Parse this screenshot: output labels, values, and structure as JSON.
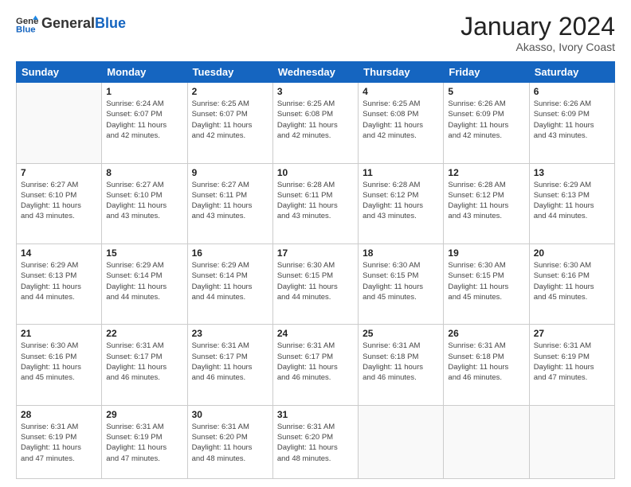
{
  "header": {
    "logo_general": "General",
    "logo_blue": "Blue",
    "month_title": "January 2024",
    "location": "Akasso, Ivory Coast"
  },
  "weekdays": [
    "Sunday",
    "Monday",
    "Tuesday",
    "Wednesday",
    "Thursday",
    "Friday",
    "Saturday"
  ],
  "weeks": [
    [
      {
        "day": "",
        "info": ""
      },
      {
        "day": "1",
        "info": "Sunrise: 6:24 AM\nSunset: 6:07 PM\nDaylight: 11 hours\nand 42 minutes."
      },
      {
        "day": "2",
        "info": "Sunrise: 6:25 AM\nSunset: 6:07 PM\nDaylight: 11 hours\nand 42 minutes."
      },
      {
        "day": "3",
        "info": "Sunrise: 6:25 AM\nSunset: 6:08 PM\nDaylight: 11 hours\nand 42 minutes."
      },
      {
        "day": "4",
        "info": "Sunrise: 6:25 AM\nSunset: 6:08 PM\nDaylight: 11 hours\nand 42 minutes."
      },
      {
        "day": "5",
        "info": "Sunrise: 6:26 AM\nSunset: 6:09 PM\nDaylight: 11 hours\nand 42 minutes."
      },
      {
        "day": "6",
        "info": "Sunrise: 6:26 AM\nSunset: 6:09 PM\nDaylight: 11 hours\nand 43 minutes."
      }
    ],
    [
      {
        "day": "7",
        "info": "Sunrise: 6:27 AM\nSunset: 6:10 PM\nDaylight: 11 hours\nand 43 minutes."
      },
      {
        "day": "8",
        "info": "Sunrise: 6:27 AM\nSunset: 6:10 PM\nDaylight: 11 hours\nand 43 minutes."
      },
      {
        "day": "9",
        "info": "Sunrise: 6:27 AM\nSunset: 6:11 PM\nDaylight: 11 hours\nand 43 minutes."
      },
      {
        "day": "10",
        "info": "Sunrise: 6:28 AM\nSunset: 6:11 PM\nDaylight: 11 hours\nand 43 minutes."
      },
      {
        "day": "11",
        "info": "Sunrise: 6:28 AM\nSunset: 6:12 PM\nDaylight: 11 hours\nand 43 minutes."
      },
      {
        "day": "12",
        "info": "Sunrise: 6:28 AM\nSunset: 6:12 PM\nDaylight: 11 hours\nand 43 minutes."
      },
      {
        "day": "13",
        "info": "Sunrise: 6:29 AM\nSunset: 6:13 PM\nDaylight: 11 hours\nand 44 minutes."
      }
    ],
    [
      {
        "day": "14",
        "info": "Sunrise: 6:29 AM\nSunset: 6:13 PM\nDaylight: 11 hours\nand 44 minutes."
      },
      {
        "day": "15",
        "info": "Sunrise: 6:29 AM\nSunset: 6:14 PM\nDaylight: 11 hours\nand 44 minutes."
      },
      {
        "day": "16",
        "info": "Sunrise: 6:29 AM\nSunset: 6:14 PM\nDaylight: 11 hours\nand 44 minutes."
      },
      {
        "day": "17",
        "info": "Sunrise: 6:30 AM\nSunset: 6:15 PM\nDaylight: 11 hours\nand 44 minutes."
      },
      {
        "day": "18",
        "info": "Sunrise: 6:30 AM\nSunset: 6:15 PM\nDaylight: 11 hours\nand 45 minutes."
      },
      {
        "day": "19",
        "info": "Sunrise: 6:30 AM\nSunset: 6:15 PM\nDaylight: 11 hours\nand 45 minutes."
      },
      {
        "day": "20",
        "info": "Sunrise: 6:30 AM\nSunset: 6:16 PM\nDaylight: 11 hours\nand 45 minutes."
      }
    ],
    [
      {
        "day": "21",
        "info": "Sunrise: 6:30 AM\nSunset: 6:16 PM\nDaylight: 11 hours\nand 45 minutes."
      },
      {
        "day": "22",
        "info": "Sunrise: 6:31 AM\nSunset: 6:17 PM\nDaylight: 11 hours\nand 46 minutes."
      },
      {
        "day": "23",
        "info": "Sunrise: 6:31 AM\nSunset: 6:17 PM\nDaylight: 11 hours\nand 46 minutes."
      },
      {
        "day": "24",
        "info": "Sunrise: 6:31 AM\nSunset: 6:17 PM\nDaylight: 11 hours\nand 46 minutes."
      },
      {
        "day": "25",
        "info": "Sunrise: 6:31 AM\nSunset: 6:18 PM\nDaylight: 11 hours\nand 46 minutes."
      },
      {
        "day": "26",
        "info": "Sunrise: 6:31 AM\nSunset: 6:18 PM\nDaylight: 11 hours\nand 46 minutes."
      },
      {
        "day": "27",
        "info": "Sunrise: 6:31 AM\nSunset: 6:19 PM\nDaylight: 11 hours\nand 47 minutes."
      }
    ],
    [
      {
        "day": "28",
        "info": "Sunrise: 6:31 AM\nSunset: 6:19 PM\nDaylight: 11 hours\nand 47 minutes."
      },
      {
        "day": "29",
        "info": "Sunrise: 6:31 AM\nSunset: 6:19 PM\nDaylight: 11 hours\nand 47 minutes."
      },
      {
        "day": "30",
        "info": "Sunrise: 6:31 AM\nSunset: 6:20 PM\nDaylight: 11 hours\nand 48 minutes."
      },
      {
        "day": "31",
        "info": "Sunrise: 6:31 AM\nSunset: 6:20 PM\nDaylight: 11 hours\nand 48 minutes."
      },
      {
        "day": "",
        "info": ""
      },
      {
        "day": "",
        "info": ""
      },
      {
        "day": "",
        "info": ""
      }
    ]
  ]
}
